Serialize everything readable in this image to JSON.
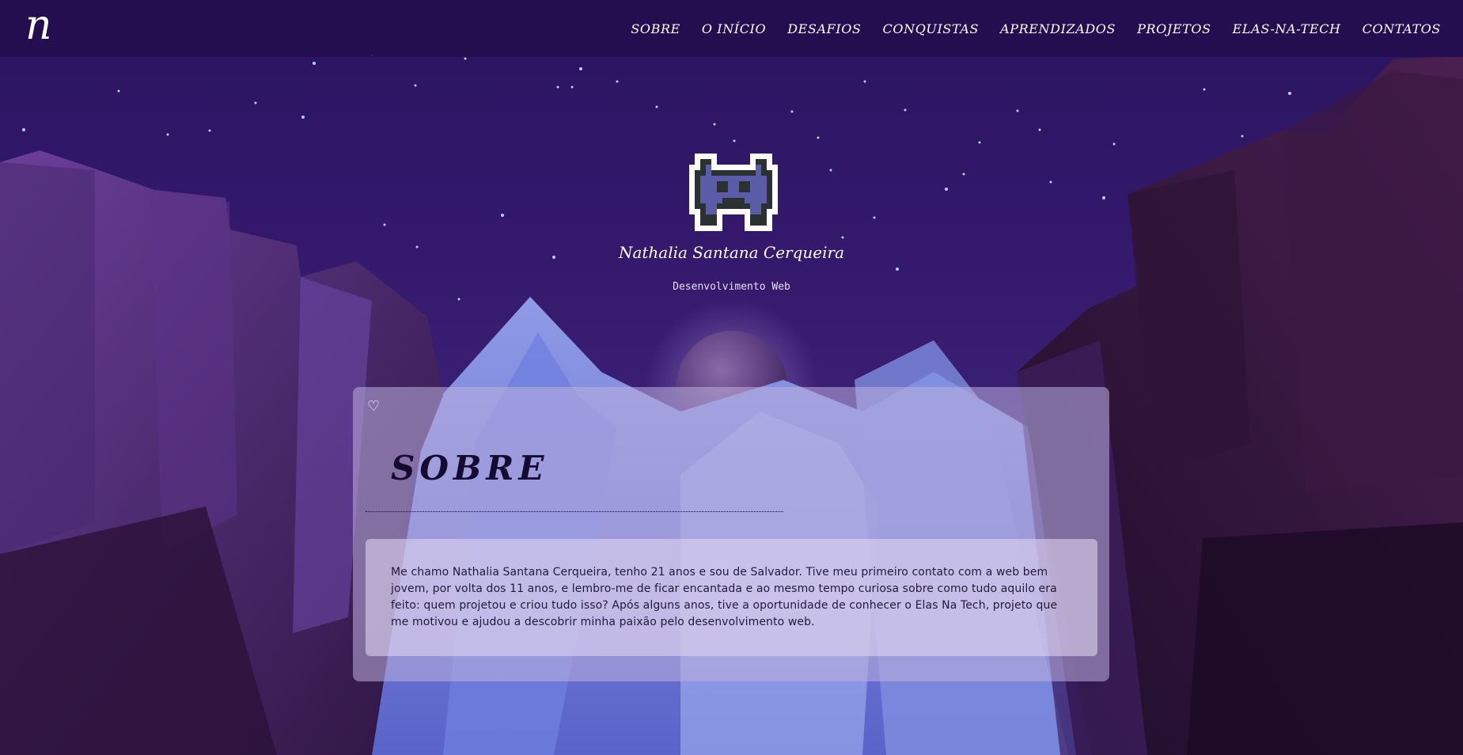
{
  "navbar": {
    "logo": "n",
    "items": [
      {
        "label": "SOBRE"
      },
      {
        "label": "O INÍCIO"
      },
      {
        "label": "DESAFIOS"
      },
      {
        "label": "CONQUISTAS"
      },
      {
        "label": "APRENDIZADOS"
      },
      {
        "label": "PROJETOS"
      },
      {
        "label": "ELAS-NA-TECH"
      },
      {
        "label": "CONTATOS"
      }
    ]
  },
  "hero": {
    "avatar_icon": "pixel-space-invader-icon",
    "name": "Nathalia Santana Cerqueira",
    "role": "Desenvolvimento Web"
  },
  "about": {
    "heart_icon": "heart-icon",
    "title": "SOBRE",
    "text": "Me chamo Nathalia Santana Cerqueira, tenho 21 anos e sou de Salvador. Tive meu primeiro contato com a web bem jovem, por volta dos 11 anos, e lembro-me de ficar encantada e ao mesmo tempo curiosa sobre como tudo aquilo era feito: quem projetou e criou tudo isso? Após alguns anos, tive a oportunidade de conhecer o Elas Na Tech, projeto que me motivou e ajudou a descobrir minha paixão pelo desenvolvimento web."
  },
  "colors": {
    "nav_bg": "#240e4e",
    "sky": "#2a1460",
    "card_bg": "#beb0de",
    "title": "#150a30"
  }
}
